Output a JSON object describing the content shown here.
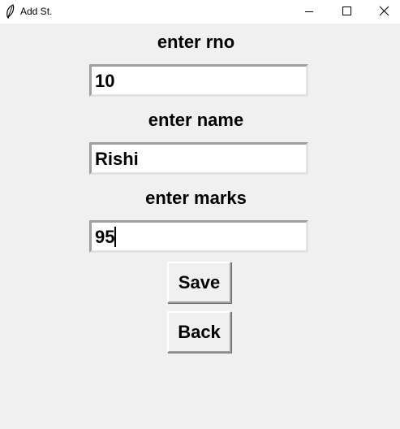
{
  "window": {
    "title": "Add St."
  },
  "form": {
    "rno_label": "enter rno",
    "rno_value": "10",
    "name_label": "enter name",
    "name_value": "Rishi",
    "marks_label": "enter marks",
    "marks_value": "95"
  },
  "buttons": {
    "save_label": "Save",
    "back_label": "Back"
  },
  "icons": {
    "app": "feather-icon",
    "minimize": "minimize-icon",
    "maximize": "maximize-icon",
    "close": "close-icon"
  }
}
